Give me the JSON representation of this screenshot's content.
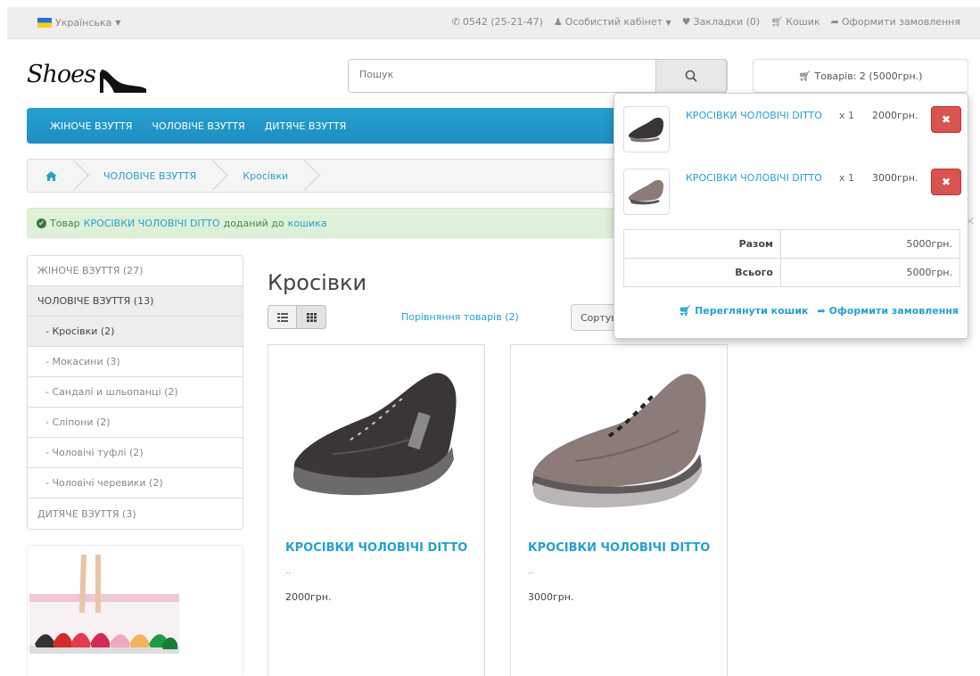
{
  "topbar": {
    "language": "Українська",
    "phone": "0542 (25-21-47)",
    "account": "Особистий кабінет",
    "wishlist": "Закладки (0)",
    "cart": "Кошик",
    "checkout": "Оформити замовлення"
  },
  "header": {
    "logo_text": "Shoes",
    "search_placeholder": "Пошук",
    "cart_summary": "Товарів: 2 (5000грн.)"
  },
  "nav": {
    "items": [
      "ЖІНОЧЕ ВЗУТТЯ",
      "ЧОЛОВІЧЕ ВЗУТТЯ",
      "ДИТЯЧЕ ВЗУТТЯ"
    ]
  },
  "breadcrumb": {
    "items": [
      "ЧОЛОВІЧЕ ВЗУТТЯ",
      "Кросівки"
    ]
  },
  "alert": {
    "prefix": "Товар",
    "product": "КРОСІВКИ ЧОЛОВІЧІ DITTO",
    "middle": "доданий до",
    "link": "кошика",
    "close": "×"
  },
  "sidebar": {
    "categories": [
      "ЖІНОЧЕ ВЗУТТЯ (27)",
      "ЧОЛОВІЧЕ ВЗУТТЯ (13)",
      "- Кросівки (2)",
      "- Мокасини (3)",
      "- Сандалі и шльопанці (2)",
      "- Сліпони (2)",
      "- Чоловічі туфлі (2)",
      "- Чоловічі черевики (2)",
      "ДИТЯЧЕ ВЗУТТЯ (3)"
    ]
  },
  "content": {
    "title": "Кросівки",
    "compare": "Порівняння товарів (2)",
    "sort_label": "Сортування"
  },
  "products": [
    {
      "name": "КРОСІВКИ ЧОЛОВІЧІ DITTO",
      "desc": "..",
      "price": "2000грн."
    },
    {
      "name": "КРОСІВКИ ЧОЛОВІЧІ DITTO",
      "desc": "..",
      "price": "3000грн."
    }
  ],
  "cart_dropdown": {
    "items": [
      {
        "name": "КРОСІВКИ ЧОЛОВІЧІ DITTO",
        "qty": "x 1",
        "price": "2000грн."
      },
      {
        "name": "КРОСІВКИ ЧОЛОВІЧІ DITTO",
        "qty": "x 1",
        "price": "3000грн."
      }
    ],
    "subtotal_label": "Разом",
    "subtotal": "5000грн.",
    "total_label": "Всього",
    "total": "5000грн.",
    "view_cart": "Переглянути кошик",
    "checkout": "Оформити замовлення"
  },
  "colors": {
    "accent": "#23a1d1",
    "nav": "#229ad0",
    "alert_bg": "#dff0d8",
    "danger": "#d9534f"
  }
}
